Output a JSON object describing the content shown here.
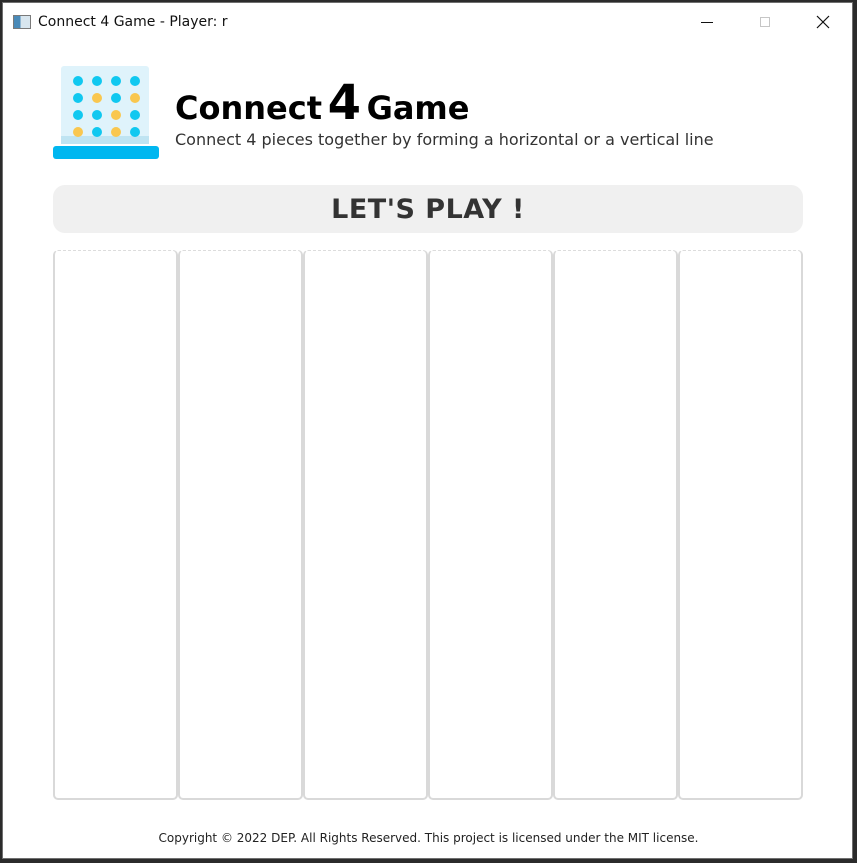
{
  "window": {
    "title": "Connect 4 Game - Player: r"
  },
  "header": {
    "title_prefix": "Connect",
    "title_number": "4",
    "title_suffix": "Game",
    "subtitle": "Connect 4 pieces together by forming a horizontal or a vertical line",
    "logo_icon": "connect-four-board-icon"
  },
  "banner": {
    "label": "LET'S PLAY !"
  },
  "board": {
    "columns": 6,
    "pieces": []
  },
  "footer": {
    "copyright": "Copyright © 2022 DEP. All Rights Reserved. This project is licensed under the MIT license."
  },
  "colors": {
    "logo_blue": "#10c8f0",
    "logo_yellow": "#f9c74f",
    "logo_panel": "#dff3fb",
    "logo_base": "#00b7f0",
    "banner_bg": "#f0f0f0",
    "column_border": "#d9d9d9"
  }
}
